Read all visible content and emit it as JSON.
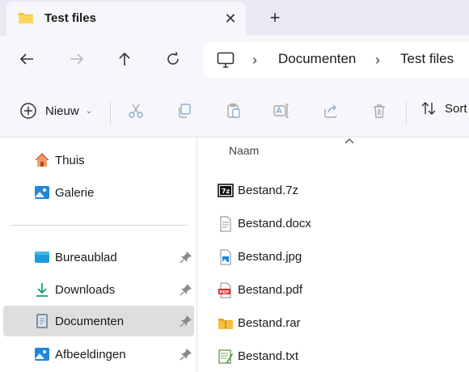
{
  "tab": {
    "title": "Test files",
    "close_icon": "close-icon",
    "new_tab_icon": "plus-icon"
  },
  "address": {
    "root_icon": "computer-icon",
    "breadcrumbs": [
      "Documenten",
      "Test files"
    ]
  },
  "commands": {
    "new_label": "Nieuw",
    "sort_label": "Sort",
    "icons": [
      "cut-icon",
      "copy-icon",
      "paste-icon",
      "rename-icon",
      "share-icon",
      "delete-icon"
    ]
  },
  "sidebar": {
    "top_items": [
      {
        "label": "Thuis",
        "icon": "home-icon"
      },
      {
        "label": "Galerie",
        "icon": "gallery-icon"
      }
    ],
    "pinned_items": [
      {
        "label": "Bureaublad",
        "icon": "desktop-icon",
        "pinned": true
      },
      {
        "label": "Downloads",
        "icon": "downloads-icon",
        "pinned": true
      },
      {
        "label": "Documenten",
        "icon": "documents-icon",
        "pinned": true,
        "selected": true
      },
      {
        "label": "Afbeeldingen",
        "icon": "pictures-icon",
        "pinned": true
      }
    ]
  },
  "files": {
    "column_header": "Naam",
    "rows": [
      {
        "name": "Bestand.7z",
        "icon": "7z-file-icon"
      },
      {
        "name": "Bestand.docx",
        "icon": "document-file-icon"
      },
      {
        "name": "Bestand.jpg",
        "icon": "image-file-icon"
      },
      {
        "name": "Bestand.pdf",
        "icon": "pdf-file-icon"
      },
      {
        "name": "Bestand.rar",
        "icon": "archive-file-icon"
      },
      {
        "name": "Bestand.txt",
        "icon": "text-file-icon"
      }
    ]
  },
  "colors": {
    "accent": "#0067c0",
    "selected_bg": "#dedede",
    "chrome_bg": "#f7f6fb",
    "tabstrip_bg": "#ebe8f3"
  }
}
